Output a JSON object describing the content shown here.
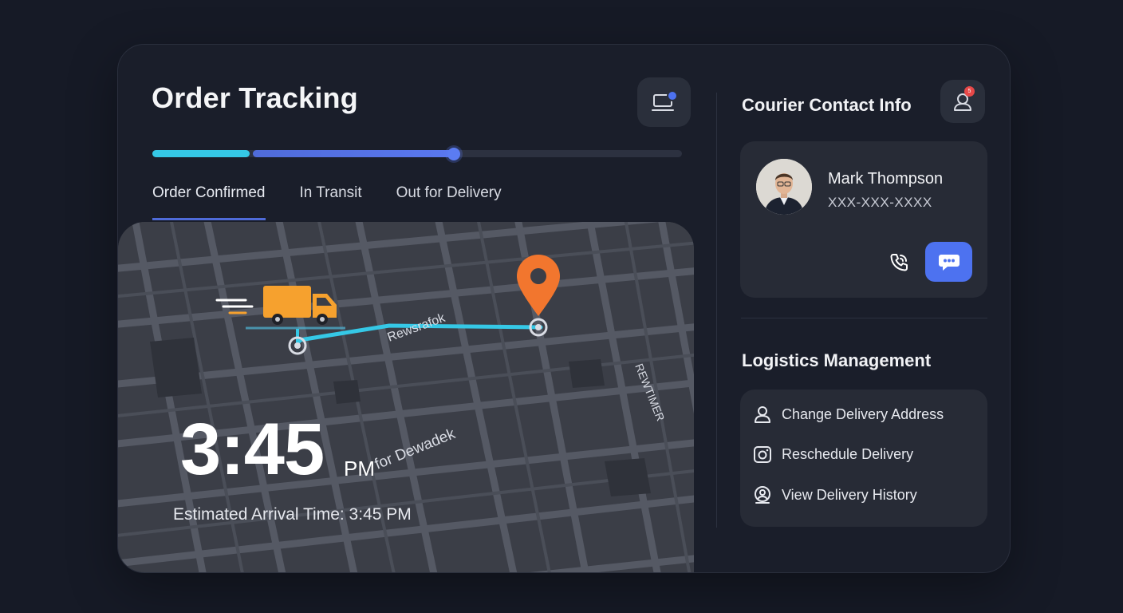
{
  "tracking": {
    "title": "Order Tracking",
    "progress": 0.57,
    "tabs": [
      {
        "label": "Order Confirmed",
        "active": true
      },
      {
        "label": "In Transit",
        "active": false
      },
      {
        "label": "Out for Delivery",
        "active": false
      }
    ]
  },
  "map": {
    "street_labels": [
      "Rewsrafok",
      "for Dewadek",
      "REWTIMER"
    ],
    "eta_time": "3:45",
    "eta_ampm": "PM",
    "eta_text": "Estimated Arrival Time: 3:45 PM"
  },
  "courier": {
    "section_title": "Courier Contact Info",
    "notification_count": "5",
    "name": "Mark Thompson",
    "phone": "XXX-XXX-XXXX"
  },
  "logistics": {
    "section_title": "Logistics Management",
    "items": [
      {
        "label": "Change Delivery Address",
        "icon": "user-icon"
      },
      {
        "label": "Reschedule Delivery",
        "icon": "calendar-icon"
      },
      {
        "label": "View Delivery History",
        "icon": "history-icon"
      }
    ]
  },
  "colors": {
    "accent_cyan": "#35c8e6",
    "accent_blue": "#4d72f0",
    "pin_orange": "#f2762e",
    "truck_orange": "#f6a12e"
  }
}
